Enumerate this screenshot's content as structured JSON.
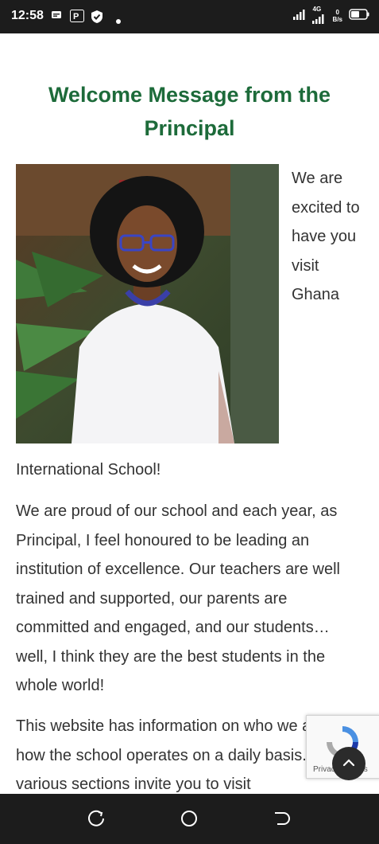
{
  "status_bar": {
    "time": "12:58",
    "network": "4G",
    "speed_value": "0",
    "speed_unit": "B/s"
  },
  "page": {
    "title": "Welcome Message from the Principal",
    "intro_wrapped": "We are excited to have you visit Ghana",
    "intro_continued": "International School!",
    "paragraph_2": "We are proud of our school and each year, as Principal, I feel honoured to be leading an institution of excellence. Our teachers are well trained and supported, our parents are committed and engaged, and our students… well, I think they are the best students in the whole world!",
    "paragraph_3": "This website has information on who we are and how the school operates on a daily basis. Our various sections invite you to visit"
  },
  "recaptcha": {
    "links": "Privacy - Terms"
  },
  "icons": {
    "back_to_top": "chevron-up-icon",
    "nav_recent": "recent-apps-icon",
    "nav_home": "home-circle-icon",
    "nav_back": "back-icon"
  },
  "colors": {
    "title_green": "#1d6b3a",
    "bar_dark": "#1c1c1c"
  }
}
